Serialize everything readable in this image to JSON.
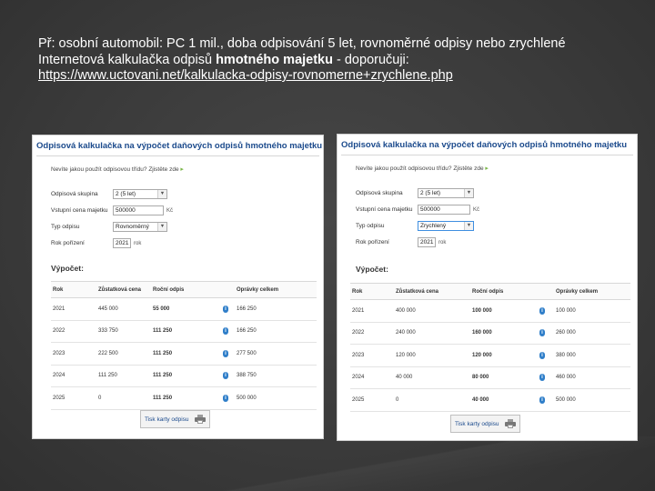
{
  "intro": {
    "line1": "Př: osobní automobil: PC 1 mil., doba odpisování 5 let, rovnoměrné odpisy nebo zrychlené",
    "line2_prefix": "Internetová kalkulačka odpisů ",
    "line2_bold": "hmotného majetku",
    "line2_suffix": " - doporučuji:",
    "link": "https://www.uctovani.net/kalkulacka-odpisy-rovnomerne+zrychlene.php"
  },
  "colors": {
    "title": "#1b4a8c",
    "info": "#2f7ec9",
    "hint_arrow": "#7ab648"
  },
  "left": {
    "title": "Odpisová kalkulačka na výpočet daňových odpisů hmotného majetku",
    "hint": "Nevíte jakou použít odpisovou třídu? Zjistěte zde",
    "labels": {
      "group": "Odpisová skupina",
      "price": "Vstupní cena majetku",
      "type": "Typ odpisu",
      "year": "Rok pořízení"
    },
    "values": {
      "group": "2 (5 let)",
      "price": "500000",
      "price_unit": "Kč",
      "type": "Rovnoměrný",
      "year": "2021",
      "year_unit": "rok"
    },
    "section": "Výpočet:",
    "headers": [
      "Rok",
      "Zůstatková cena",
      "Roční odpis",
      "",
      "Oprávky celkem"
    ],
    "rows": [
      [
        "2021",
        "445 000",
        "55 000",
        "166 250"
      ],
      [
        "2022",
        "333 750",
        "111 250",
        "166 250"
      ],
      [
        "2023",
        "222 500",
        "111 250",
        "277 500"
      ],
      [
        "2024",
        "111 250",
        "111 250",
        "388 750"
      ],
      [
        "2025",
        "0",
        "111 250",
        "500 000"
      ]
    ],
    "print": "Tisk karty odpisu"
  },
  "right": {
    "title": "Odpisová kalkulačka na výpočet daňových odpisů hmotného majetku",
    "hint": "Nevíte jakou použít odpisovou třídu? Zjistěte zde",
    "labels": {
      "group": "Odpisová skupina",
      "price": "Vstupní cena majetku",
      "type": "Typ odpisu",
      "year": "Rok pořízení"
    },
    "values": {
      "group": "2 (5 let)",
      "price": "500000",
      "price_unit": "Kč",
      "type": "Zrychlený",
      "year": "2021",
      "year_unit": "rok"
    },
    "section": "Výpočet:",
    "headers": [
      "Rok",
      "Zůstatková cena",
      "Roční odpis",
      "",
      "Oprávky celkem"
    ],
    "rows": [
      [
        "2021",
        "400 000",
        "100 000",
        "100 000"
      ],
      [
        "2022",
        "240 000",
        "160 000",
        "260 000"
      ],
      [
        "2023",
        "120 000",
        "120 000",
        "380 000"
      ],
      [
        "2024",
        "40 000",
        "80 000",
        "460 000"
      ],
      [
        "2025",
        "0",
        "40 000",
        "500 000"
      ]
    ],
    "print": "Tisk karty odpisu"
  }
}
